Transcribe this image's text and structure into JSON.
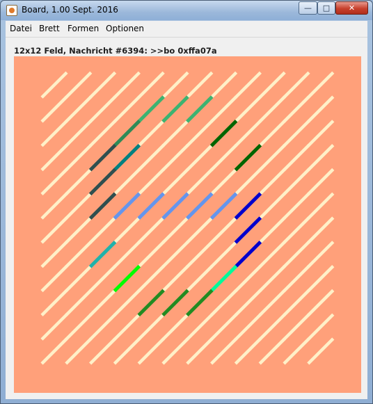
{
  "window": {
    "title": "Board, 1.00 Sept. 2016",
    "minimize_label": "—",
    "maximize_label": "□",
    "close_label": "✕"
  },
  "menu": {
    "items": [
      "Datei",
      "Brett",
      "Formen",
      "Optionen"
    ]
  },
  "status": "12x12 Feld, Nachricht #6394: >>bo 0xffa07a",
  "colors": {
    "board_background": "#ffa07a",
    "default_segment": "#fff0c8"
  },
  "board": {
    "rows": 12,
    "cols": 12,
    "colored_segments": [
      {
        "row": 1,
        "col": 4,
        "color": "#3cb371"
      },
      {
        "row": 1,
        "col": 5,
        "color": "#3cb371"
      },
      {
        "row": 1,
        "col": 6,
        "color": "#3cb371"
      },
      {
        "row": 2,
        "col": 3,
        "color": "#2e8b57"
      },
      {
        "row": 2,
        "col": 7,
        "color": "#006400"
      },
      {
        "row": 3,
        "col": 2,
        "color": "#2f4f4f"
      },
      {
        "row": 3,
        "col": 3,
        "color": "#008080"
      },
      {
        "row": 3,
        "col": 8,
        "color": "#006400"
      },
      {
        "row": 4,
        "col": 2,
        "color": "#2f4f4f"
      },
      {
        "row": 5,
        "col": 2,
        "color": "#2f4f4f"
      },
      {
        "row": 5,
        "col": 3,
        "color": "#6495ed"
      },
      {
        "row": 5,
        "col": 4,
        "color": "#6495ed"
      },
      {
        "row": 5,
        "col": 5,
        "color": "#6495ed"
      },
      {
        "row": 5,
        "col": 6,
        "color": "#6495ed"
      },
      {
        "row": 5,
        "col": 7,
        "color": "#6495ed"
      },
      {
        "row": 5,
        "col": 8,
        "color": "#0000cd"
      },
      {
        "row": 6,
        "col": 8,
        "color": "#0000cd"
      },
      {
        "row": 7,
        "col": 2,
        "color": "#20b2aa"
      },
      {
        "row": 7,
        "col": 8,
        "color": "#0000cd"
      },
      {
        "row": 8,
        "col": 3,
        "color": "#00ff00"
      },
      {
        "row": 8,
        "col": 7,
        "color": "#00fa9a"
      },
      {
        "row": 9,
        "col": 4,
        "color": "#228b22"
      },
      {
        "row": 9,
        "col": 5,
        "color": "#228b22"
      },
      {
        "row": 9,
        "col": 6,
        "color": "#228b22"
      }
    ]
  }
}
